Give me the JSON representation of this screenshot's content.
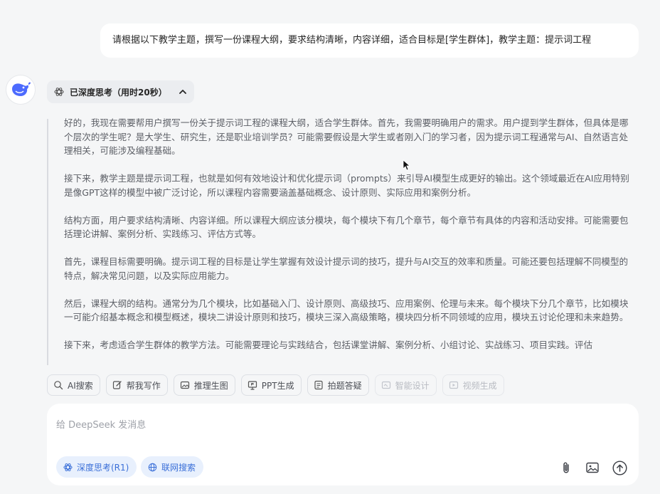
{
  "user_message": "请根据以下教学主题，撰写一份课程大纲，要求结构清晰，内容详细，适合目标是[学生群体]，教学主题：提示词工程",
  "assistant": {
    "think_label": "已深度思考（用时20秒）",
    "paragraphs": [
      "好的，我现在需要帮用户撰写一份关于提示词工程的课程大纲，适合学生群体。首先，我需要明确用户的需求。用户提到学生群体，但具体是哪个层次的学生呢？是大学生、研究生，还是职业培训学员？可能需要假设是大学生或者刚入门的学习者，因为提示词工程通常与AI、自然语言处理相关，可能涉及编程基础。",
      "接下来，教学主题是提示词工程，也就是如何有效地设计和优化提示词（prompts）来引导AI模型生成更好的输出。这个领域最近在AI应用特别是像GPT这样的模型中被广泛讨论，所以课程内容需要涵盖基础概念、设计原则、实际应用和案例分析。",
      "结构方面，用户要求结构清晰、内容详细。所以课程大纲应该分模块，每个模块下有几个章节，每个章节有具体的内容和活动安排。可能需要包括理论讲解、案例分析、实践练习、评估方式等。",
      "首先，课程目标需要明确。提示词工程的目标是让学生掌握有效设计提示词的技巧，提升与AI交互的效率和质量。可能还要包括理解不同模型的特点，解决常见问题，以及实际应用能力。",
      "然后，课程大纲的结构。通常分为几个模块，比如基础入门、设计原则、高级技巧、应用案例、伦理与未来。每个模块下分几个章节，比如模块一可能介绍基本概念和模型概述，模块二讲设计原则和技巧，模块三深入高级策略，模块四分析不同领域的应用，模块五讨论伦理和未来趋势。",
      "接下来，考虑适合学生群体的教学方法。可能需要理论与实践结合，包括课堂讲解、案例分析、小组讨论、实战练习、项目实践。评估"
    ]
  },
  "chips": [
    {
      "label": "AI搜索",
      "icon": "ai-search-icon",
      "enabled": true
    },
    {
      "label": "帮我写作",
      "icon": "edit-icon",
      "enabled": true
    },
    {
      "label": "推理生图",
      "icon": "image-gen-icon",
      "enabled": true
    },
    {
      "label": "PPT生成",
      "icon": "ppt-icon",
      "enabled": true
    },
    {
      "label": "拍题答疑",
      "icon": "document-icon",
      "enabled": true
    },
    {
      "label": "智能设计",
      "icon": "design-icon",
      "enabled": false
    },
    {
      "label": "视频生成",
      "icon": "video-icon",
      "enabled": false
    }
  ],
  "composer": {
    "placeholder": "给 DeepSeek 发消息",
    "deep_think_label": "深度思考(R1)",
    "web_search_label": "联网搜索"
  },
  "colors": {
    "background": "#f5f6f7",
    "accent": "#3a6fd8",
    "brand": "#4d6bfe"
  }
}
